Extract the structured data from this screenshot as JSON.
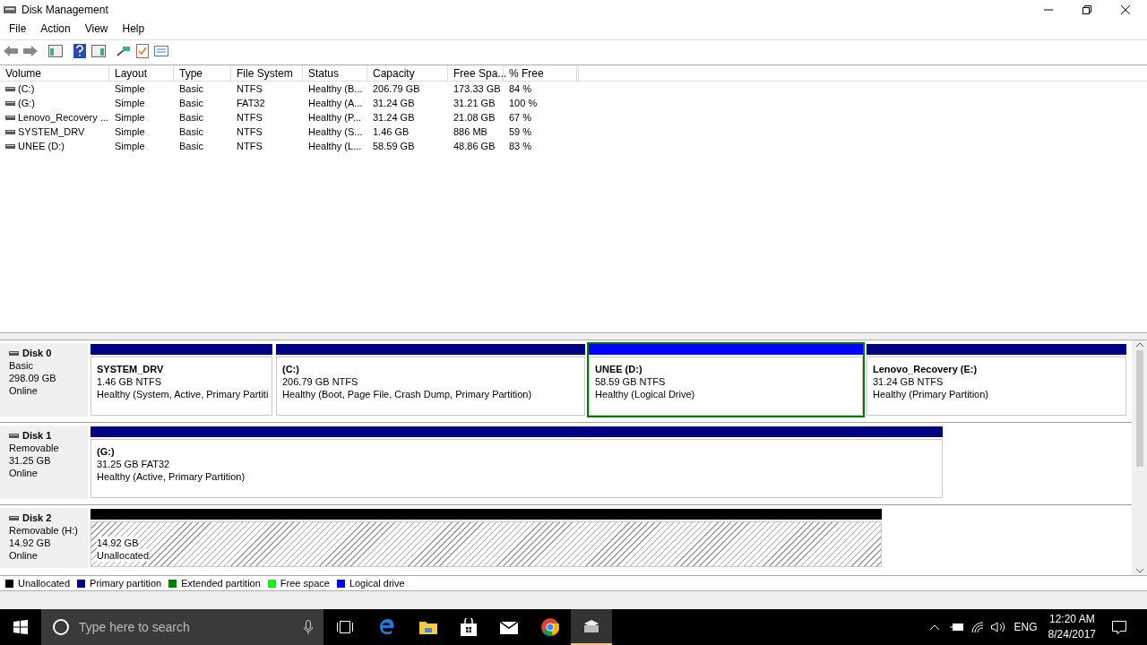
{
  "window": {
    "title": "Disk Management"
  },
  "menu": [
    "File",
    "Action",
    "View",
    "Help"
  ],
  "table": {
    "columns": [
      "Volume",
      "Layout",
      "Type",
      "File System",
      "Status",
      "Capacity",
      "Free Spa...",
      "% Free"
    ],
    "rows": [
      {
        "cells": [
          "(C:)",
          "Simple",
          "Basic",
          "NTFS",
          "Healthy (B...",
          "206.79 GB",
          "173.33 GB",
          "84 %"
        ]
      },
      {
        "cells": [
          "(G:)",
          "Simple",
          "Basic",
          "FAT32",
          "Healthy (A...",
          "31.24 GB",
          "31.21 GB",
          "100 %"
        ]
      },
      {
        "cells": [
          "Lenovo_Recovery ...",
          "Simple",
          "Basic",
          "NTFS",
          "Healthy (P...",
          "31.24 GB",
          "21.08 GB",
          "67 %"
        ]
      },
      {
        "cells": [
          "SYSTEM_DRV",
          "Simple",
          "Basic",
          "NTFS",
          "Healthy (S...",
          "1.46 GB",
          "886 MB",
          "59 %"
        ]
      },
      {
        "cells": [
          "UNEE (D:)",
          "Simple",
          "Basic",
          "NTFS",
          "Healthy (L...",
          "58.59 GB",
          "48.86 GB",
          "83 %"
        ]
      }
    ]
  },
  "disks": [
    {
      "name": "Disk 0",
      "type": "Basic",
      "size": "298.09 GB",
      "state": "Online",
      "partitions": [
        {
          "kind": "primary",
          "selected": false,
          "name": "SYSTEM_DRV",
          "size": "1.46 GB NTFS",
          "status": "Healthy (System, Active, Primary Partiti"
        },
        {
          "kind": "primary",
          "selected": false,
          "name": "(C:)",
          "size": "206.79 GB NTFS",
          "status": "Healthy (Boot, Page File, Crash Dump, Primary Partition)"
        },
        {
          "kind": "logical",
          "selected": true,
          "name": "UNEE  (D:)",
          "size": "58.59 GB NTFS",
          "status": "Healthy (Logical Drive)"
        },
        {
          "kind": "primary",
          "selected": false,
          "name": "Lenovo_Recovery  (E:)",
          "size": "31.24 GB NTFS",
          "status": "Healthy (Primary Partition)"
        }
      ]
    },
    {
      "name": "Disk 1",
      "type": "Removable",
      "size": "31.25 GB",
      "state": "Online",
      "partitions": [
        {
          "kind": "primary",
          "selected": false,
          "name": "(G:)",
          "size": "31.25 GB FAT32",
          "status": "Healthy (Active, Primary Partition)"
        }
      ]
    },
    {
      "name": "Disk 2",
      "type": "Removable (H:)",
      "size": "14.92 GB",
      "state": "Online",
      "partitions": [
        {
          "kind": "unallocated",
          "selected": false,
          "size": "14.92 GB",
          "status": "Unallocated"
        }
      ]
    }
  ],
  "legend": [
    {
      "label": "Unallocated",
      "color": "#000000"
    },
    {
      "label": "Primary partition",
      "color": "#000080"
    },
    {
      "label": "Extended partition",
      "color": "#008000"
    },
    {
      "label": "Free space",
      "color": "#00ff00"
    },
    {
      "label": "Logical drive",
      "color": "#0000ff"
    }
  ],
  "taskbar": {
    "search": {
      "placeholder": "Type here to search"
    },
    "language": "ENG",
    "time": "12:20 AM",
    "date": "8/24/2017"
  }
}
